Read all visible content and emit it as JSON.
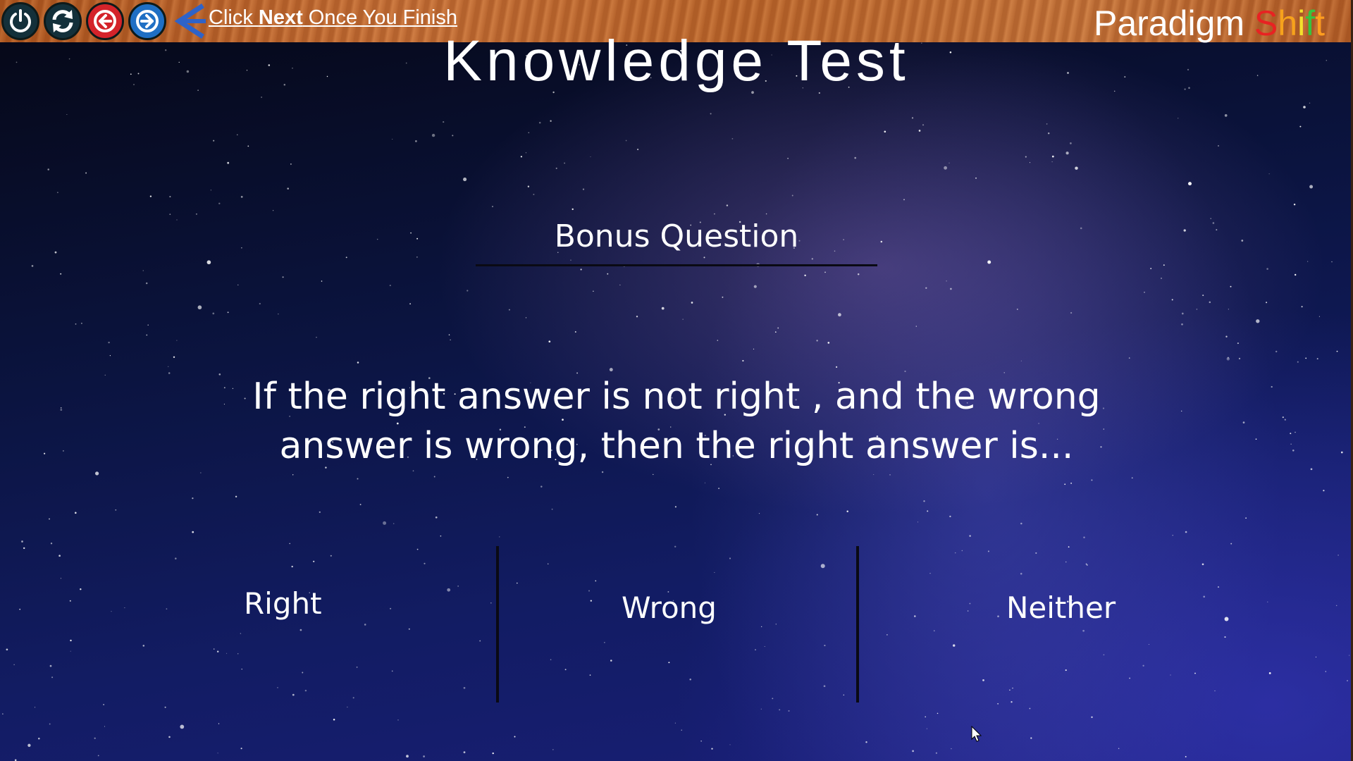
{
  "toolbar": {
    "hint_prefix": "Click ",
    "hint_bold": "Next",
    "hint_suffix": " Once You Finish",
    "brand_main": "Paradigm ",
    "brand_accent": [
      "S",
      "h",
      "i",
      "f",
      "t"
    ],
    "icons": [
      "power-icon",
      "refresh-icon",
      "back-arrow-icon",
      "forward-arrow-icon",
      "left-arrow-icon"
    ]
  },
  "main": {
    "title": "Knowledge Test",
    "bonus_heading": "Bonus Question",
    "question": "If the right answer is not right , and the wrong answer is wrong, then the right answer is...",
    "answers": [
      "Right",
      "Wrong",
      "Neither"
    ]
  },
  "colors": {
    "power_button": "#13303a",
    "back_button": "#d4232a",
    "forward_button": "#1f6fc4",
    "toolbar_wood": "#c9733a",
    "brand_accent": [
      "#e82222",
      "#f6a21c",
      "#f3e12c",
      "#37c43f",
      "#ff9d1e"
    ]
  }
}
